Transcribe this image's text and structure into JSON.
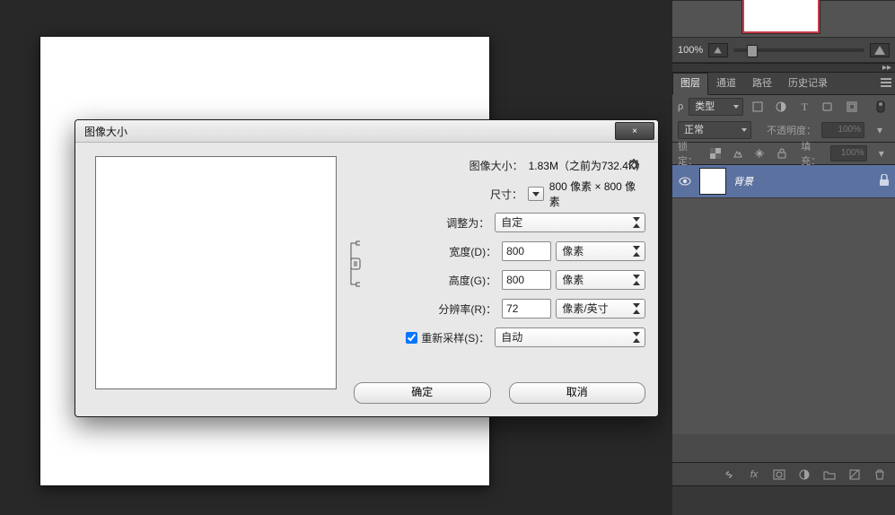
{
  "dialog": {
    "title": "图像大小",
    "close": "×",
    "info_label": "图像大小：",
    "info_value": "1.83M（之前为732.4K）",
    "size_label": "尺寸：",
    "size_value": "800 像素 × 800 像素",
    "fitto_label": "调整为：",
    "fitto_value": "自定",
    "width_label": "宽度(D)：",
    "width_value": "800",
    "width_unit": "像素",
    "height_label": "高度(G)：",
    "height_value": "800",
    "height_unit": "像素",
    "res_label": "分辨率(R)：",
    "res_value": "72",
    "res_unit": "像素/英寸",
    "resample_label": "重新采样(S)：",
    "resample_value": "自动",
    "ok": "确定",
    "cancel": "取消"
  },
  "navigator": {
    "zoom": "100%"
  },
  "layers_panel": {
    "tabs": {
      "layers": "图层",
      "channels": "通道",
      "paths": "路径",
      "history": "历史记录"
    },
    "kind": "类型",
    "blend": "正常",
    "opacity_label": "不透明度：",
    "opacity_value": "100%",
    "lock_label": "锁定：",
    "fill_label": "填充：",
    "fill_value": "100%",
    "layer": {
      "name": "背景"
    }
  }
}
